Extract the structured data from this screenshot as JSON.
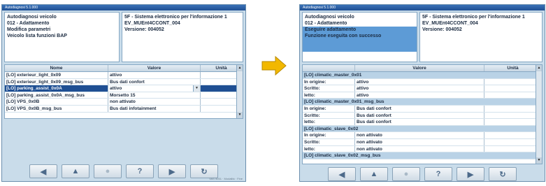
{
  "left": {
    "title_bar": "Autodiagnosi 5.1.000",
    "header_left": [
      "Autodiagnosi veicolo",
      "012 - Adattamento",
      "Modifica parametri",
      "Veicolo lista funzioni BAP"
    ],
    "header_right": [
      "5F - Sistema elettronico per l'informazione 1",
      "EV_MUEnt4CCONT_004",
      "Versione: 004052"
    ],
    "columns": [
      "Nome",
      "Valore",
      "Unità"
    ],
    "rows": [
      {
        "name": "[LO] exterieur_light_0x09",
        "value": "attivo",
        "unit": ""
      },
      {
        "name": "[LO] exterieur_light_0x09_msg_bus",
        "value": "Bus dati confort",
        "unit": ""
      },
      {
        "name": "[LO] parking_assist_0x0A",
        "value": "attivo",
        "unit": ""
      },
      {
        "name": "[LO] parking_assist_0x0A_msg_bus",
        "value": "Morsetto 15",
        "unit": ""
      },
      {
        "name": "[LO] VPS_0x0B",
        "value": "non attivato",
        "unit": ""
      },
      {
        "name": "[LO] VPS_0x0B_msg_bus",
        "value": "Bus dati infotainment",
        "unit": ""
      }
    ],
    "status": "VAS 5051 · Modalità · Fine"
  },
  "right": {
    "title_bar": "Autodiagnosi 5.1.000",
    "header_left": [
      "Autodiagnosi veicolo",
      "012 - Adattamento",
      "Eseguire adattamento",
      "Funzione eseguita con successo"
    ],
    "header_right": [
      "5F - Sistema elettronico per l'informazione 1",
      "EV_MUEnt4CCONT_004",
      "Versione: 004052"
    ],
    "columns": [
      "",
      "Valore",
      "Unità"
    ],
    "rows": [
      {
        "group": "[LO] climatic_master_0x01"
      },
      {
        "label": "In origine:",
        "value": "attivo"
      },
      {
        "label": "Scritto:",
        "value": "attivo"
      },
      {
        "label": "letto:",
        "value": "attivo"
      },
      {
        "group": "[LO] climatic_master_0x01_msg_bus"
      },
      {
        "label": "In origine:",
        "value": "Bus dati confort"
      },
      {
        "label": "Scritto:",
        "value": "Bus dati confort"
      },
      {
        "label": "letto:",
        "value": "Bus dati confort"
      },
      {
        "group": "[LO] climatic_slave_0x02"
      },
      {
        "label": "In origine:",
        "value": "non attivato"
      },
      {
        "label": "Scritto:",
        "value": "non attivato"
      },
      {
        "label": "letto:",
        "value": "non attivato"
      },
      {
        "group": "[LO] climatic_slave_0x02_msg_bus"
      }
    ]
  },
  "toolbar": [
    "◀",
    "▲",
    "●",
    "?",
    "▶",
    "↻"
  ],
  "accent": "#5d9bd6",
  "arrow_color": "#f2b800"
}
